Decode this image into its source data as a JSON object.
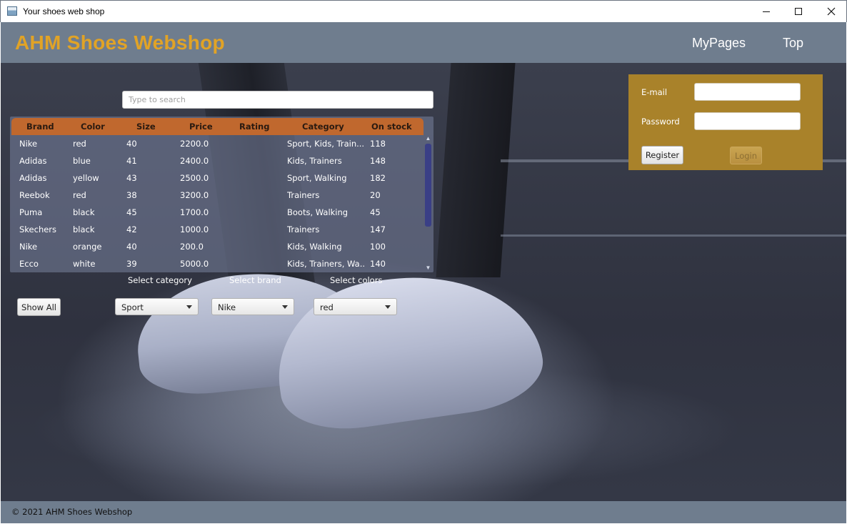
{
  "window": {
    "title": "Your shoes web shop",
    "controls": {
      "minimize": "minimize-icon",
      "maximize": "maximize-icon",
      "close": "close-icon"
    }
  },
  "header": {
    "brand": "AHM Shoes Webshop",
    "nav": [
      "MyPages",
      "Top"
    ],
    "colors": {
      "bar": "#6f7d8e",
      "brand": "#e1a326"
    }
  },
  "search": {
    "placeholder": "Type to search",
    "value": ""
  },
  "table": {
    "columns": [
      "Brand",
      "Color",
      "Size",
      "Price",
      "Rating",
      "Category",
      "On stock"
    ],
    "rows": [
      [
        "Nike",
        "red",
        "40",
        "2200.0",
        "",
        "Sport, Kids, Train...",
        "118"
      ],
      [
        "Adidas",
        "blue",
        "41",
        "2400.0",
        "",
        "Kids, Trainers",
        "148"
      ],
      [
        "Adidas",
        "yellow",
        "43",
        "2500.0",
        "",
        "Sport, Walking",
        "182"
      ],
      [
        "Reebok",
        "red",
        "38",
        "3200.0",
        "",
        "Trainers",
        "20"
      ],
      [
        "Puma",
        "black",
        "45",
        "1700.0",
        "",
        "Boots, Walking",
        "45"
      ],
      [
        "Skechers",
        "black",
        "42",
        "1000.0",
        "",
        "Trainers",
        "147"
      ],
      [
        "Nike",
        "orange",
        "40",
        "200.0",
        "",
        "Kids, Walking",
        "100"
      ],
      [
        "Ecco",
        "white",
        "39",
        "5000.0",
        "",
        "Kids, Trainers, Wa...",
        "140"
      ]
    ],
    "header_color": "#c0682e"
  },
  "filters": {
    "show_all_label": "Show All",
    "category": {
      "label": "Select category",
      "selected": "Sport"
    },
    "brand": {
      "label": "Select brand",
      "selected": "Nike"
    },
    "color": {
      "label": "Select colors",
      "selected": "red"
    }
  },
  "login": {
    "email_label": "E-mail",
    "email_value": "",
    "password_label": "Password",
    "password_value": "",
    "register_label": "Register",
    "login_label": "Login",
    "panel_color": "#a9822a"
  },
  "footer": {
    "copyright": "© 2021 AHM Shoes Webshop"
  }
}
